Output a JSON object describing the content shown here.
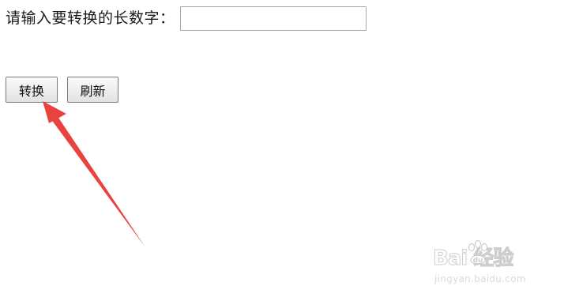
{
  "form": {
    "label": "请输入要转换的长数字：",
    "input_value": "",
    "input_placeholder": ""
  },
  "buttons": {
    "convert_label": "转换",
    "refresh_label": "刷新"
  },
  "watermark": {
    "brand": "Bai  经验",
    "url": "jingyan.baidu.com"
  },
  "colors": {
    "arrow": "#e8433f"
  }
}
